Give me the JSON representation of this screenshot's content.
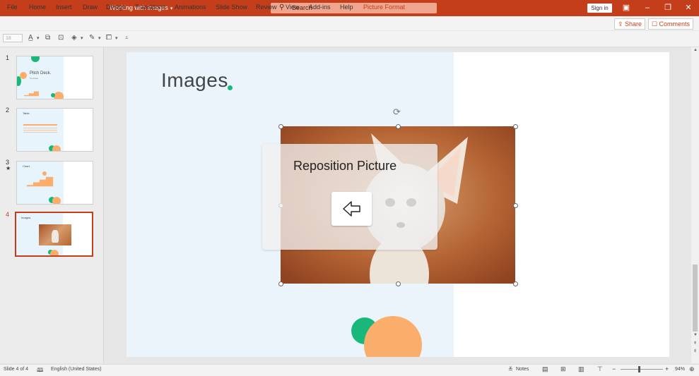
{
  "app": {
    "document_title": "Working with images",
    "search_placeholder": "Search",
    "sign_in": "Sign in"
  },
  "menu": {
    "items": [
      "File",
      "Home",
      "Insert",
      "Draw",
      "Design",
      "Transitions",
      "Animations",
      "Slide Show",
      "Review",
      "View",
      "Add-ins",
      "Help",
      "Picture Format"
    ],
    "share": "Share",
    "comments": "Comments"
  },
  "ribbon": {
    "font_size": "18"
  },
  "thumbnails": [
    {
      "number": "1",
      "title": "Pitch Deck.",
      "subtitle": "Template"
    },
    {
      "number": "2",
      "title": "Table."
    },
    {
      "number": "3",
      "title": "Chart.",
      "marker": "★"
    },
    {
      "number": "4",
      "title": "Images."
    }
  ],
  "slide": {
    "title": "Images"
  },
  "overlay": {
    "title": "Reposition Picture"
  },
  "status": {
    "slide_info": "Slide 4 of 4",
    "language": "English (United States)",
    "notes": "Notes",
    "zoom": "94%"
  },
  "colors": {
    "accent": "#c43e1c",
    "green": "#19b87a",
    "orange": "#fbad6c"
  }
}
